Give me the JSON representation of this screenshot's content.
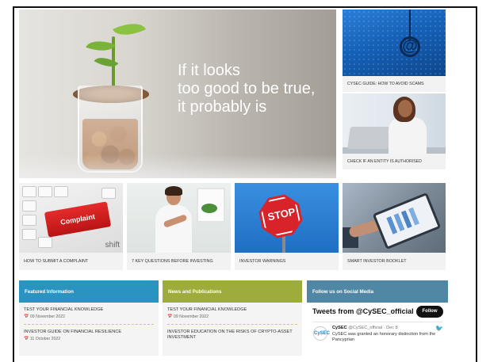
{
  "hero": {
    "slogan_line1": "If it looks",
    "slogan_line2": "too good to be true,",
    "slogan_line3": "it probably is"
  },
  "side": {
    "card1_label": "CYSEC GUIDE: HOW TO AVOID SCAMS",
    "card2_label": "CHECK IF AN ENTITY IS AUTHORISED"
  },
  "tiles": [
    {
      "label": "HOW TO SUBMIT A COMPLAINT",
      "image_text": "Complaint",
      "image_text2": "shift"
    },
    {
      "label": "7 KEY QUESTIONS BEFORE INVESTING"
    },
    {
      "label": "INVESTOR WARNINGS",
      "image_text": "STOP"
    },
    {
      "label": "SMART INVESTOR BOOKLET"
    }
  ],
  "panels": {
    "featured": {
      "title": "Featured Information",
      "items": [
        {
          "title": "TEST YOUR FINANCIAL KNOWLEDGE",
          "date": "09 November 2022"
        },
        {
          "title": "INVESTOR GUIDE ON FINANCIAL RESILIENCE",
          "date": "11 October 2022"
        }
      ]
    },
    "news": {
      "title": "News and Publications",
      "items": [
        {
          "title": "TEST YOUR FINANCIAL KNOWLEDGE",
          "date": "09 November 2022"
        },
        {
          "title": "INVESTOR EDUCATION ON THE RISKS OF CRYPTO-ASSET INVESTMENT",
          "date": ""
        }
      ]
    },
    "social": {
      "title": "Follow us on Social Media",
      "tweets_title": "Tweets from @CySEC_official",
      "follow_label": "Follow",
      "avatar_text": "CySEC",
      "tweet_name": "CySEC",
      "tweet_handle": "@CySEC_official · Dec 8",
      "tweet_text": "CySEC was granted an honorary distinction from the Pancyprian"
    }
  },
  "colors": {
    "featured_header": "#2a93bf",
    "news_header": "#9eac3c",
    "social_header": "#4f87a4"
  },
  "icons": {
    "calendar": "calendar-icon",
    "twitter": "twitter-bird-icon"
  }
}
